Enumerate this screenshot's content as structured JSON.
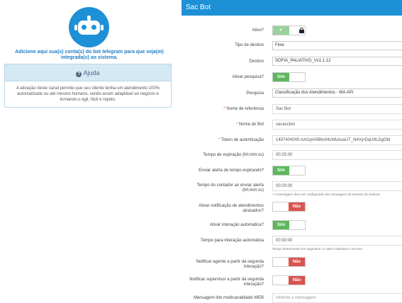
{
  "left": {
    "add_text": "Adicione aqui sua(s) conta(s) do bot telegram para que seja(m) integrada(s) ao sistema.",
    "help_title": "Ajuda",
    "help_body": "A ativação deste canal permite que seu cliente tenha um atendimento 100% automatizado ou até mesmo humano, sendo assim adaptável ao negócio e tornando-o ágil, fácil e rápido."
  },
  "right": {
    "title": "Sac Bot",
    "fields": {
      "ativo_label": "Ativo?",
      "ativo_value": "✔",
      "tipo_destino_label": "Tipo de destino",
      "tipo_destino_value": "Flow",
      "destino_label": "Destino",
      "destino_value": "SOFIA_PALIATIVO_Vs1.1.12",
      "ativar_pesquisa_label": "Ativar pesquisa?",
      "ativar_pesquisa_value": "Sim",
      "pesquisa_label": "Pesquisa",
      "pesquisa_value": "Classificação dos Atendimentos - WA API",
      "nome_referencia_label": "Nome de referência",
      "nome_referencia_value": "Sac Bot",
      "nome_bot_label": "Nome do Bot",
      "nome_bot_value": "sacascbot",
      "token_label": "Token de autenticação",
      "token_value": "1497404000:AAGpA0B6x04cWkAoaUT_N4VyrDqU9LDgObl",
      "tempo_expiracao_label": "Tempo de expiração (hh:mm:ss)",
      "tempo_expiracao_value": "00:25:00",
      "alerta_expirando_label": "Enviar alerta de tempo expirando?",
      "alerta_expirando_value": "Sim",
      "tempo_contador_label": "Tempo do contador ao enviar alerta (hh:mm:ss)",
      "tempo_contador_value": "00:20:00",
      "tempo_contador_hint": "* A mensagem deve ser configurada nas mensagens de eventos do sistema",
      "notif_atrasados_label": "Ativar notificação de atendimentos atrasados?",
      "notif_atrasados_value": "Não",
      "interacao_auto_label": "Ativar interação automática?",
      "interacao_auto_value": "Sim",
      "tempo_interacao_label": "Tempo para interação automática",
      "tempo_interacao_value": "00:30:00",
      "tempo_interacao_hint": "Tempo determinado em segundos. O valor 0 desativa o recurso.",
      "notif_agente_label": "Notificar agente a partir da segunda interação?",
      "notif_agente_value": "Não",
      "notif_supervisor_label": "Notificar supervisor a partir da segunda interação?",
      "notif_supervisor_value": "Não",
      "mensagem_link_label": "Mensagem link multicanalidade WEB",
      "mensagem_link_placeholder": "Informe a mensagem"
    }
  },
  "colors": {
    "accent": "#1e90d6",
    "success": "#5cb85c",
    "danger": "#d9534f"
  }
}
